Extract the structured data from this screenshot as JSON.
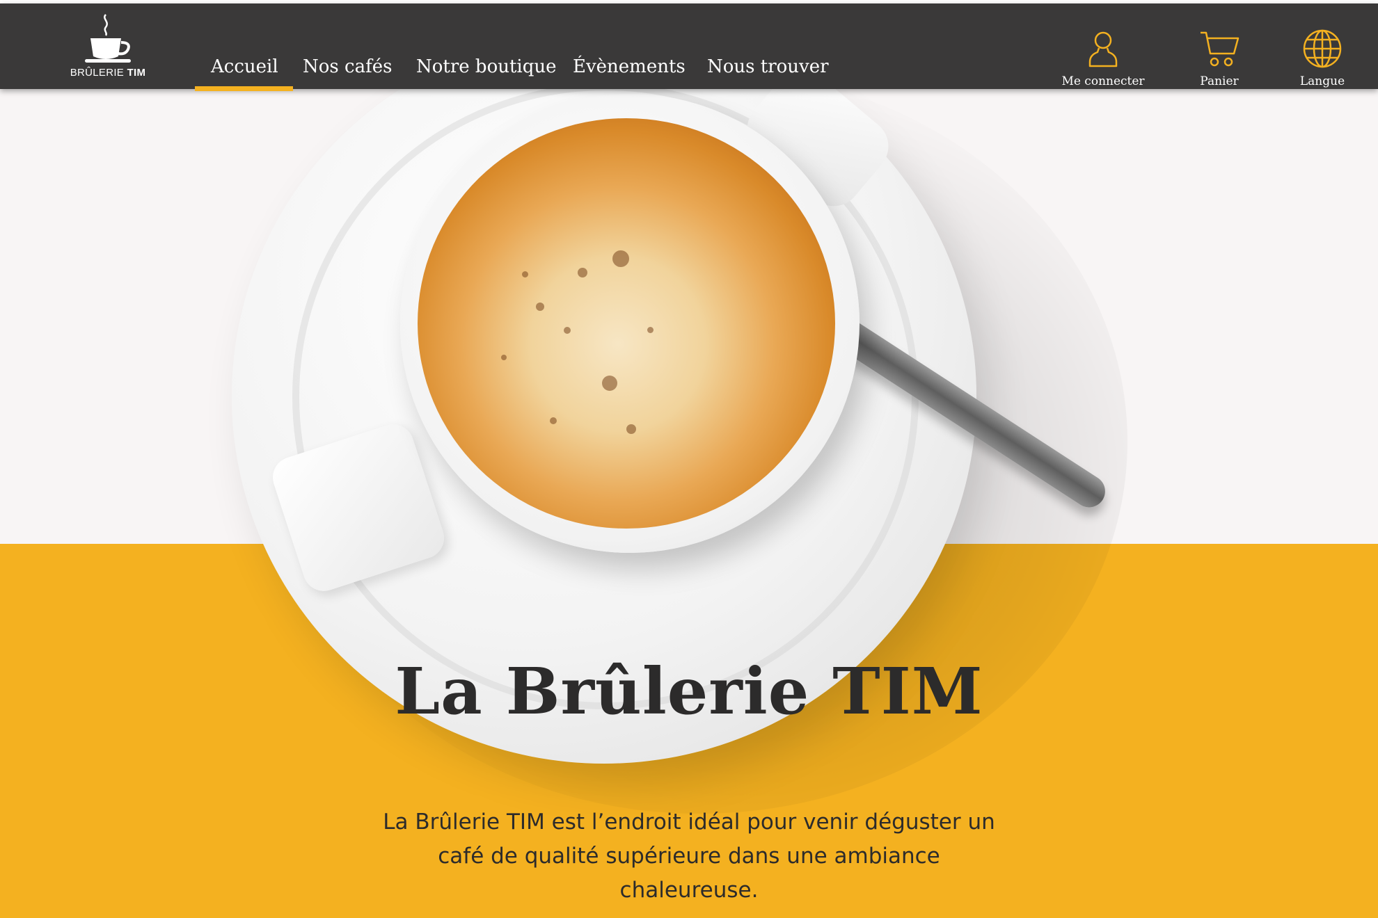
{
  "brand": {
    "name_part1": "BRÛLERIE",
    "name_part2": "TIM",
    "logo_icon": "coffee-cup-icon"
  },
  "nav": {
    "items": [
      {
        "label": "Accueil",
        "active": true
      },
      {
        "label": "Nos cafés",
        "active": false
      },
      {
        "label": "Notre boutique",
        "active": false
      },
      {
        "label": "Évènements",
        "active": false
      },
      {
        "label": "Nous trouver",
        "active": false
      }
    ]
  },
  "utility": {
    "login": {
      "label": "Me connecter",
      "icon": "user-icon"
    },
    "cart": {
      "label": "Panier",
      "icon": "cart-icon"
    },
    "language": {
      "label": "Langue",
      "icon": "globe-icon"
    }
  },
  "hero": {
    "title": "La Brûlerie TIM",
    "description": "La Brûlerie TIM est l’endroit idéal pour venir déguster un café de qualité supérieure dans une ambiance chaleureuse."
  },
  "colors": {
    "navbar": "#3a3939",
    "accent": "#f4b120",
    "text_dark": "#2c2b2b",
    "hero_light": "#f8f5f5"
  }
}
